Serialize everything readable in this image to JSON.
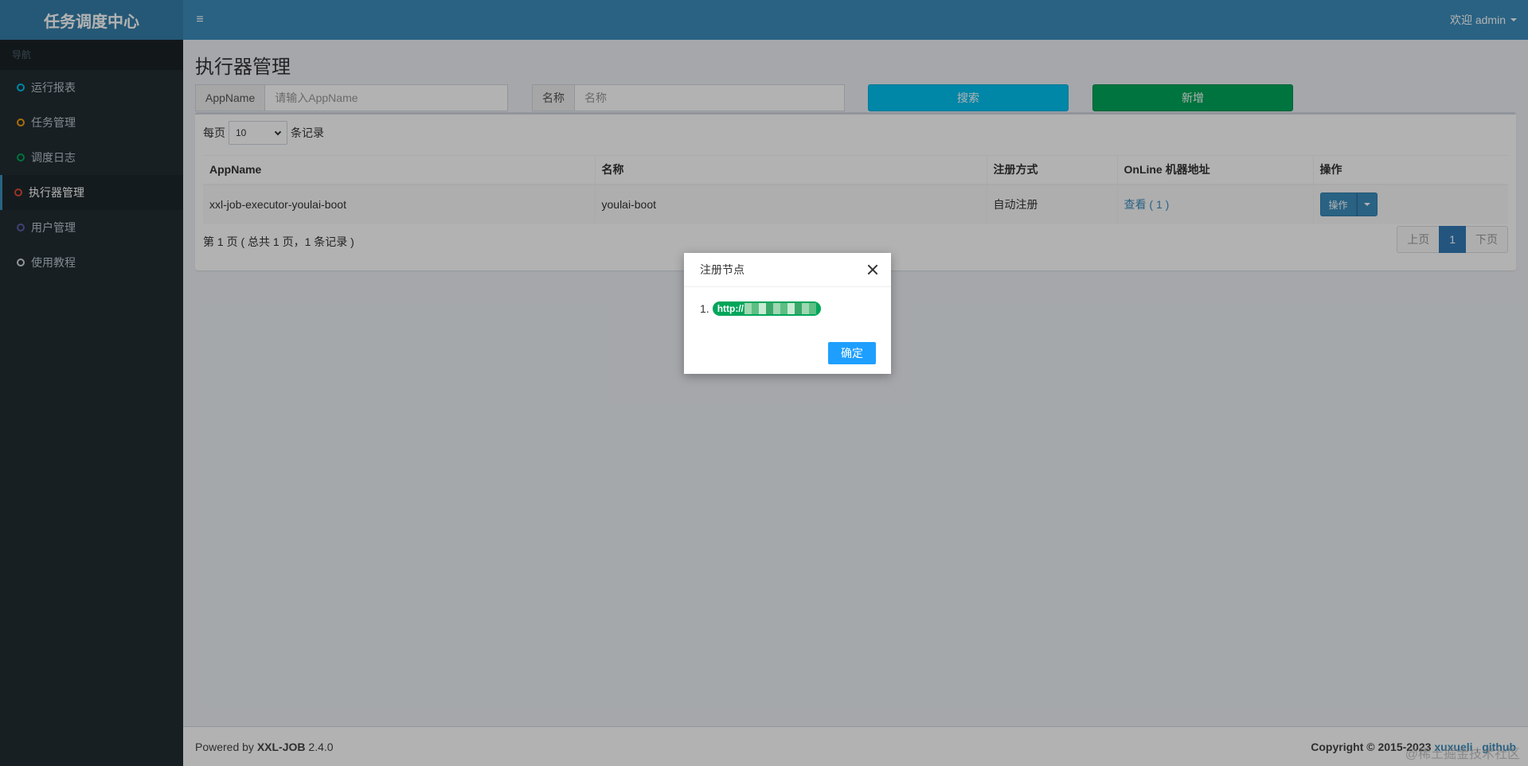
{
  "header": {
    "logo": "任务调度中心",
    "toggle_icon": "≡",
    "user": "欢迎 admin"
  },
  "sidebar": {
    "nav_header": "导航",
    "items": [
      {
        "label": "运行报表",
        "color": "#00c0ef"
      },
      {
        "label": "任务管理",
        "color": "#f39c12"
      },
      {
        "label": "调度日志",
        "color": "#00a65a"
      },
      {
        "label": "执行器管理",
        "color": "#dd4b39"
      },
      {
        "label": "用户管理",
        "color": "#605ca8"
      },
      {
        "label": "使用教程",
        "color": "#d2d6de"
      }
    ]
  },
  "main": {
    "title": "执行器管理",
    "filters": {
      "appname_label": "AppName",
      "appname_placeholder": "请输入AppName",
      "name_label": "名称",
      "name_placeholder": "名称",
      "search_label": "搜索",
      "add_label": "新增"
    },
    "length": {
      "prefix": "每页",
      "value": "10",
      "suffix": "条记录"
    },
    "table": {
      "columns": [
        "AppName",
        "名称",
        "注册方式",
        "OnLine 机器地址",
        "操作"
      ],
      "rows": [
        {
          "appname": "xxl-job-executor-youlai-boot",
          "name": "youlai-boot",
          "register_type": "自动注册",
          "online": "查看 ( 1 )",
          "action": "操作"
        }
      ]
    },
    "pagination": {
      "info": "第 1 页 ( 总共 1 页，1 条记录 )",
      "prev": "上页",
      "current": "1",
      "next": "下页"
    }
  },
  "footer": {
    "powered_prefix": "Powered by",
    "product": "XXL-JOB",
    "version": "2.4.0",
    "copyright": "Copyright © 2015-2023",
    "author_link": "xuxueli",
    "github_link": "github"
  },
  "watermark": "@稀土掘金技术社区",
  "modal": {
    "title": "注册节点",
    "item_number": "1.",
    "item_prefix": "http://",
    "confirm_label": "确定"
  },
  "colors": {
    "header": "#3c8dbc",
    "sidebar": "#222d32",
    "search_button": "#00c0ef",
    "add_button": "#00a65a",
    "confirm_button": "#1e9fff"
  }
}
